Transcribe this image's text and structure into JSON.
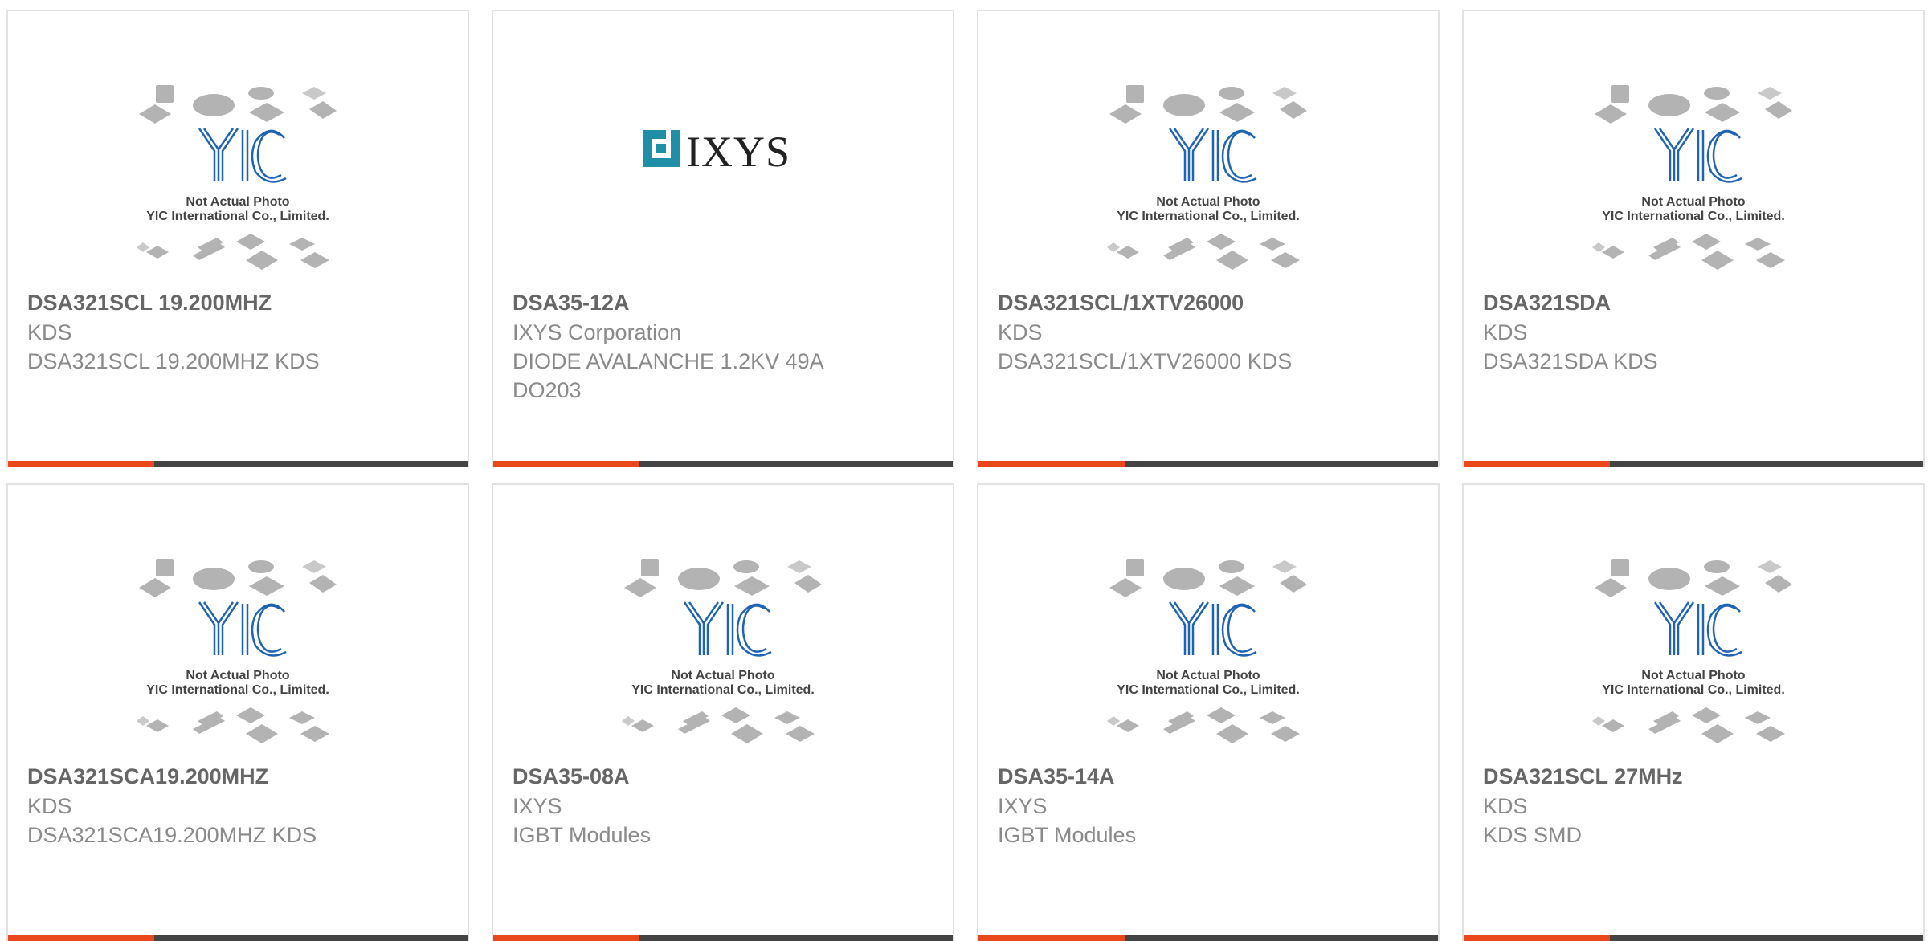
{
  "colors": {
    "accent": "#e8481c",
    "bar": "#444444",
    "title": "#666666",
    "text": "#8a8a8a",
    "border": "#e2e2e2"
  },
  "placeholder": {
    "brand_mark": "YIC",
    "line1": "Not Actual Photo",
    "line2": "YIC International Co., Limited."
  },
  "products": [
    {
      "title": "DSA321SCL 19.200MHZ",
      "brand": "KDS",
      "desc": "DSA321SCL 19.200MHZ KDS",
      "image": "placeholder"
    },
    {
      "title": "DSA35-12A",
      "brand": "IXYS Corporation",
      "desc": "DIODE AVALANCHE 1.2KV 49A DO203",
      "image": "ixys",
      "logo_text": "IXYS"
    },
    {
      "title": "DSA321SCL/1XTV26000",
      "brand": "KDS",
      "desc": "DSA321SCL/1XTV26000 KDS",
      "image": "placeholder"
    },
    {
      "title": "DSA321SDA",
      "brand": "KDS",
      "desc": "DSA321SDA KDS",
      "image": "placeholder"
    },
    {
      "title": "DSA321SCA19.200MHZ",
      "brand": "KDS",
      "desc": "DSA321SCA19.200MHZ KDS",
      "image": "placeholder"
    },
    {
      "title": "DSA35-08A",
      "brand": "IXYS",
      "desc": "IGBT Modules",
      "image": "placeholder"
    },
    {
      "title": "DSA35-14A",
      "brand": "IXYS",
      "desc": "IGBT Modules",
      "image": "placeholder"
    },
    {
      "title": "DSA321SCL 27MHz",
      "brand": "KDS",
      "desc": "KDS SMD",
      "image": "placeholder"
    }
  ]
}
